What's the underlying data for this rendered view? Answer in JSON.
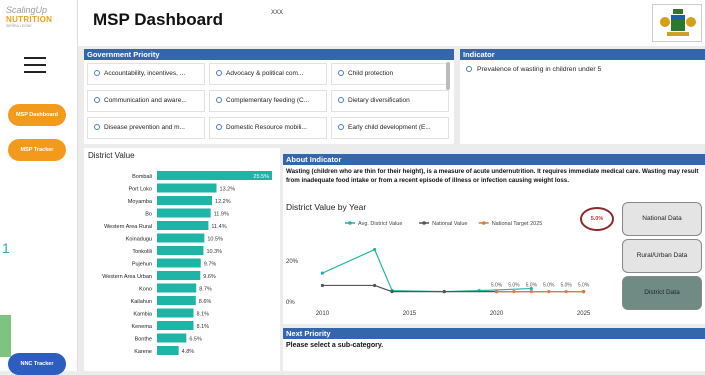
{
  "app": {
    "title": "MSP Dashboard",
    "subtitle": "XXX"
  },
  "logo": {
    "line1": "ScalingUp",
    "line2": "NUTRITION",
    "line3": "SIERRA LEONE"
  },
  "sidebar": {
    "buttons": [
      {
        "label": "MSP Dashboard"
      },
      {
        "label": "MSP Tracker"
      },
      {
        "label": "NNC Tracker"
      }
    ]
  },
  "government_priority": {
    "header": "Government Priority",
    "items": [
      "Accountability, incentives, ...",
      "Advocacy & political com...",
      "Child protection",
      "Communication and aware...",
      "Complementary feeding (C...",
      "Dietary diversification",
      "Disease prevention and m...",
      "Domestic Resource mobili...",
      "Early child development (E..."
    ]
  },
  "indicator": {
    "header": "Indicator",
    "item": "Prevalence of wasting in children under 5"
  },
  "district_value": {
    "title": "District Value",
    "bars": [
      {
        "name": "Bombali",
        "value": 25.5,
        "label": "25.5%"
      },
      {
        "name": "Port Loko",
        "value": 13.2,
        "label": "13.2%"
      },
      {
        "name": "Moyamba",
        "value": 12.2,
        "label": "12.2%"
      },
      {
        "name": "Bo",
        "value": 11.9,
        "label": "11.9%"
      },
      {
        "name": "Western Area Rural",
        "value": 11.4,
        "label": "11.4%"
      },
      {
        "name": "Koinadugu",
        "value": 10.5,
        "label": "10.5%"
      },
      {
        "name": "Tonkolili",
        "value": 10.3,
        "label": "10.3%"
      },
      {
        "name": "Pujehun",
        "value": 9.7,
        "label": "9.7%"
      },
      {
        "name": "Western Area Urban",
        "value": 9.6,
        "label": "9.6%"
      },
      {
        "name": "Kono",
        "value": 8.7,
        "label": "8.7%"
      },
      {
        "name": "Kailahun",
        "value": 8.6,
        "label": "8.6%"
      },
      {
        "name": "Kambia",
        "value": 8.1,
        "label": "8.1%"
      },
      {
        "name": "Kenema",
        "value": 8.1,
        "label": "8.1%"
      },
      {
        "name": "Bonthe",
        "value": 6.5,
        "label": "6.5%"
      },
      {
        "name": "Karene",
        "value": 4.8,
        "label": "4.8%"
      }
    ],
    "bar_color": "#1fb5a6"
  },
  "about": {
    "header": "About Indicator",
    "text": "Wasting (children who are thin for their height), is a measure of acute undernutrition. It requires immediate medical care. Wasting may result from inadequate food intake or from a recent episode of illness or infection causing weight loss."
  },
  "chart_data": {
    "type": "line",
    "title": "District Value by Year",
    "xlim": [
      2009,
      2026
    ],
    "ylim": [
      -2,
      35
    ],
    "xticks": [
      "2010",
      "2015",
      "2020",
      "2025"
    ],
    "yticks": [
      "0%",
      "20%"
    ],
    "series": [
      {
        "name": "Avg. District Value",
        "color": "#1fb5a6",
        "points": [
          [
            2010,
            14
          ],
          [
            2013,
            25.5
          ],
          [
            2014,
            5.5
          ],
          [
            2017,
            5
          ],
          [
            2019,
            5.5
          ],
          [
            2022,
            6.5
          ]
        ]
      },
      {
        "name": "National Value",
        "color": "#555555",
        "points": [
          [
            2010,
            8
          ],
          [
            2013,
            8
          ],
          [
            2014,
            5
          ],
          [
            2017,
            5
          ],
          [
            2020,
            5
          ],
          [
            2025,
            5
          ]
        ]
      },
      {
        "name": "National Target 2025",
        "color": "#e07b39",
        "points": [
          [
            2020,
            5
          ],
          [
            2021,
            5
          ],
          [
            2022,
            5
          ],
          [
            2023,
            5
          ],
          [
            2024,
            5
          ],
          [
            2025,
            5
          ]
        ]
      }
    ],
    "labels": [
      "5.0%",
      "5.0%",
      "5.0%",
      "5.0%",
      "5.0%",
      "5.0%"
    ],
    "target_badge": "5.0%"
  },
  "data_buttons": [
    {
      "label": "National Data"
    },
    {
      "label": "Rural/Urban Data"
    },
    {
      "label": "District Data"
    }
  ],
  "next_priority": {
    "header": "Next Priority",
    "text": "Please select a sub-category."
  }
}
